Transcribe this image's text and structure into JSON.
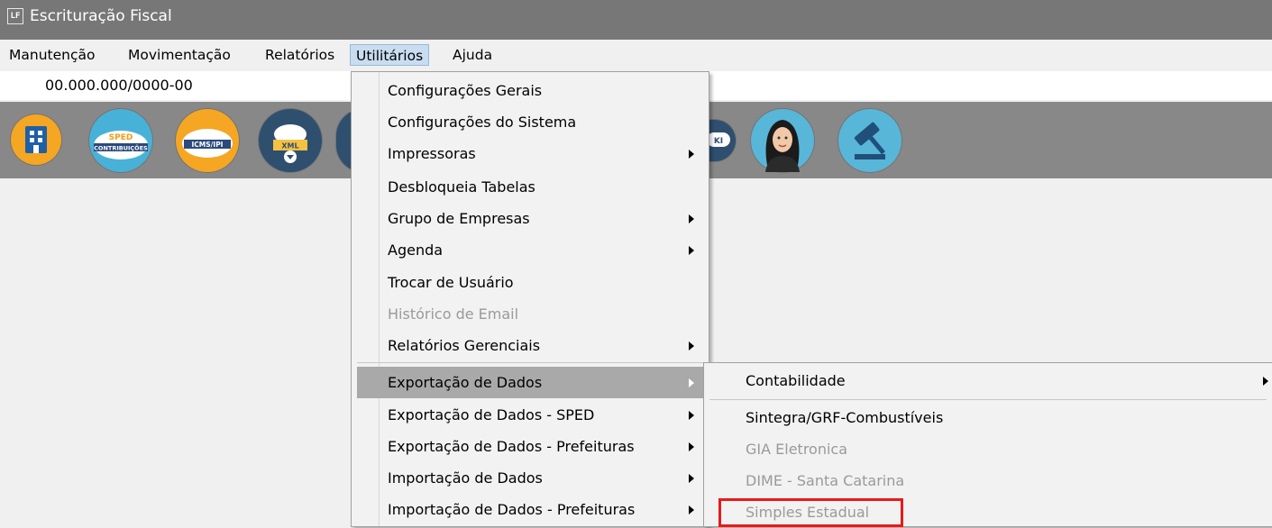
{
  "window": {
    "title": "Escrituração Fiscal",
    "app_icon_text": "LF"
  },
  "menubar": {
    "items": [
      {
        "label": "Manutenção",
        "active": false
      },
      {
        "label": "Movimentação",
        "active": false
      },
      {
        "label": "Relatórios",
        "active": false
      },
      {
        "label": "Utilitários",
        "active": true
      },
      {
        "label": "Ajuda",
        "active": false
      }
    ]
  },
  "company_bar": {
    "cnpj": "00.000.000/0000-00"
  },
  "toolbar": {
    "buttons": [
      {
        "name": "empresa-icon"
      },
      {
        "name": "sped-contribuicoes-icon",
        "line1": "SPED",
        "line2": "CONTRIBUIÇÕES"
      },
      {
        "name": "icms-ipi-icon",
        "line1": "ICMS/IPI"
      },
      {
        "name": "xml-download-icon",
        "line1": "XML"
      },
      {
        "name": "wiki-icon",
        "line1": "KI"
      },
      {
        "name": "assistant-avatar-icon"
      },
      {
        "name": "legal-gavel-icon"
      }
    ]
  },
  "utilitarios_menu": {
    "items": [
      {
        "label": "Configurações Gerais",
        "submenu": false,
        "disabled": false
      },
      {
        "label": "Configurações do Sistema",
        "submenu": false,
        "disabled": false
      },
      {
        "label": "Impressoras",
        "submenu": true,
        "disabled": false
      },
      {
        "label": "Desbloqueia Tabelas",
        "submenu": false,
        "disabled": false
      },
      {
        "label": "Grupo de Empresas",
        "submenu": true,
        "disabled": false
      },
      {
        "label": "Agenda",
        "submenu": true,
        "disabled": false
      },
      {
        "label": "Trocar de Usuário",
        "submenu": false,
        "disabled": false
      },
      {
        "label": "Histórico de Email",
        "submenu": false,
        "disabled": true
      },
      {
        "label": "Relatórios Gerenciais",
        "submenu": true,
        "disabled": false
      },
      {
        "label": "Exportação de Dados",
        "submenu": true,
        "disabled": false,
        "highlighted": true
      },
      {
        "label": "Exportação de Dados - SPED",
        "submenu": true,
        "disabled": false
      },
      {
        "label": "Exportação de Dados - Prefeituras",
        "submenu": true,
        "disabled": false
      },
      {
        "label": "Importação de Dados",
        "submenu": true,
        "disabled": false
      },
      {
        "label": "Importação de Dados - Prefeituras",
        "submenu": true,
        "disabled": false
      }
    ]
  },
  "exportacao_submenu": {
    "items": [
      {
        "label": "Contabilidade",
        "submenu": true,
        "disabled": false
      },
      {
        "label": "Sintegra/GRF-Combustíveis",
        "submenu": false,
        "disabled": false
      },
      {
        "label": "GIA Eletronica",
        "submenu": false,
        "disabled": true
      },
      {
        "label": "DIME - Santa Catarina",
        "submenu": false,
        "disabled": true
      },
      {
        "label": "Simples Estadual",
        "submenu": false,
        "disabled": true,
        "annotated": true
      }
    ]
  },
  "colors": {
    "titlebar": "#777777",
    "toolbar": "#888888",
    "highlight": "#a9a9a9",
    "annotation": "#e81a1a"
  }
}
